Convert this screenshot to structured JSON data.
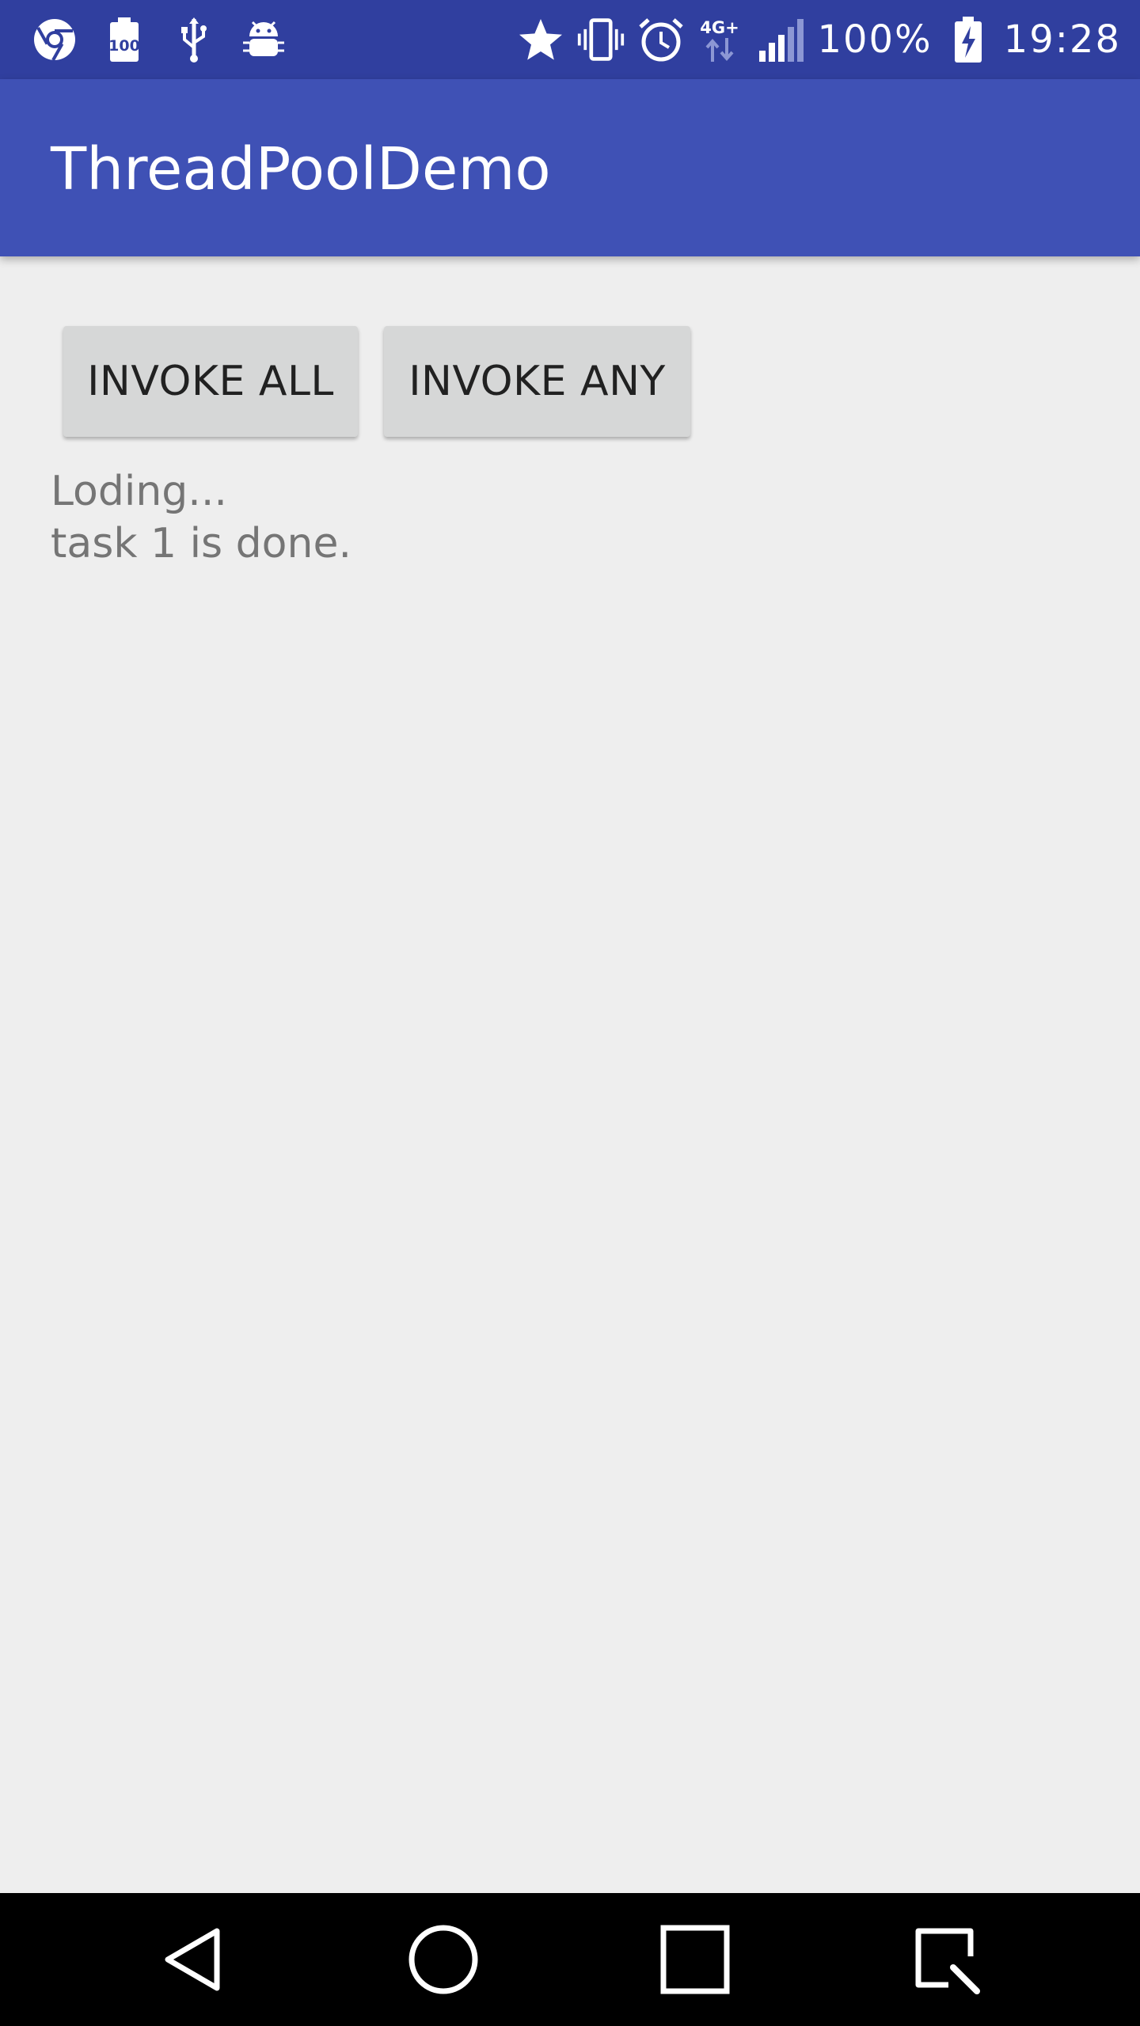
{
  "status_bar": {
    "left_icons": [
      "chrome-icon",
      "battery-100-icon",
      "usb-icon",
      "android-debug-icon"
    ],
    "right_icons": [
      "star-icon",
      "vibrate-icon",
      "alarm-icon",
      "network-4g-icon",
      "signal-icon",
      "battery-charging-icon"
    ],
    "network_label": "4G+",
    "battery_percent": "100%",
    "time": "19:28",
    "colors": {
      "background": "#303f9f"
    }
  },
  "app_bar": {
    "title": "ThreadPoolDemo",
    "colors": {
      "background": "#3f51b5"
    }
  },
  "main": {
    "invoke_all_label": "INVOKE ALL",
    "invoke_any_label": "INVOKE ANY",
    "log_lines": [
      "Loding...",
      "task 1 is done."
    ]
  },
  "nav_bar": {
    "icons": [
      "back-icon",
      "home-icon",
      "recents-icon",
      "screenshot-icon"
    ]
  },
  "colors": {
    "background": "#eeeeee",
    "button": "#d6d7d7",
    "log_text": "#757575"
  }
}
